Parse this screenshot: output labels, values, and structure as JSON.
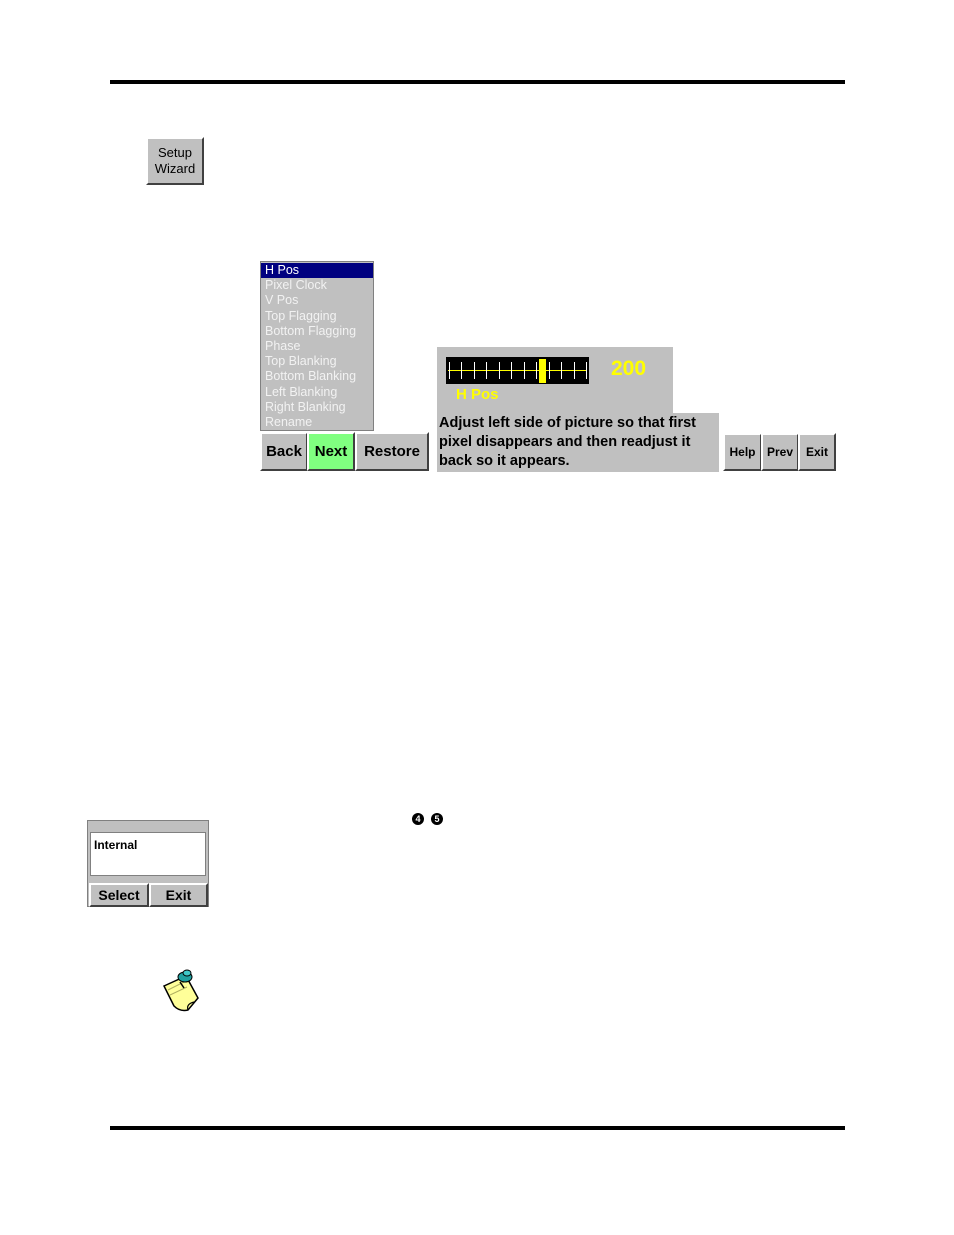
{
  "setup_button": {
    "line1": "Setup",
    "line2": "Wizard"
  },
  "list": {
    "items": [
      "H Pos",
      "Pixel Clock",
      "V Pos",
      "Top Flagging",
      "Bottom Flagging",
      "Phase",
      "Top Blanking",
      "Bottom Blanking",
      "Left Blanking",
      "Right Blanking",
      "Rename"
    ],
    "selected": "H Pos"
  },
  "nav": {
    "back": "Back",
    "next": "Next",
    "restore": "Restore"
  },
  "slider": {
    "value": "200",
    "label": "H Pos",
    "position_fraction": 0.67,
    "ticks": 12
  },
  "help_text": "Adjust left side of picture so that first pixel disappears and then readjust it back so it appears.",
  "side_buttons": {
    "help": "Help",
    "prev": "Prev",
    "exit": "Exit"
  },
  "circled_numbers": [
    "4",
    "5"
  ],
  "mini_dialog": {
    "field_value": "Internal",
    "select": "Select",
    "exit": "Exit"
  },
  "colors": {
    "selection": "#000080",
    "next_highlight": "#80ff80",
    "slider_accent": "#ffff00",
    "panel": "#c0c0c0"
  },
  "icons": {
    "note": "note-pin-icon"
  }
}
